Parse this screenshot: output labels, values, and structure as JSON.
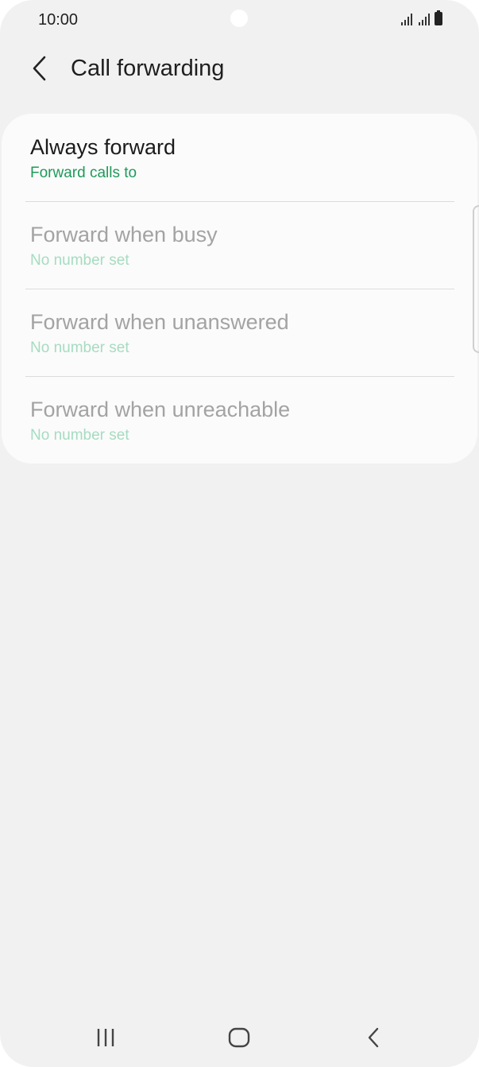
{
  "status_bar": {
    "time": "10:00"
  },
  "app_bar": {
    "title": "Call forwarding",
    "back_icon": "chevron-left-icon"
  },
  "options": [
    {
      "title": "Always forward",
      "subtitle": "Forward calls to",
      "enabled": true
    },
    {
      "title": "Forward when busy",
      "subtitle": "No number set",
      "enabled": false
    },
    {
      "title": "Forward when unanswered",
      "subtitle": "No number set",
      "enabled": false
    },
    {
      "title": "Forward when unreachable",
      "subtitle": "No number set",
      "enabled": false
    }
  ],
  "nav_bar": {
    "recents_icon": "recents-icon",
    "home_icon": "home-icon",
    "back_icon": "back-icon"
  },
  "colors": {
    "background": "#f1f1f1",
    "card": "#fbfbfb",
    "accent_green": "#1f9a5a",
    "accent_green_disabled": "#a6dcc1"
  }
}
